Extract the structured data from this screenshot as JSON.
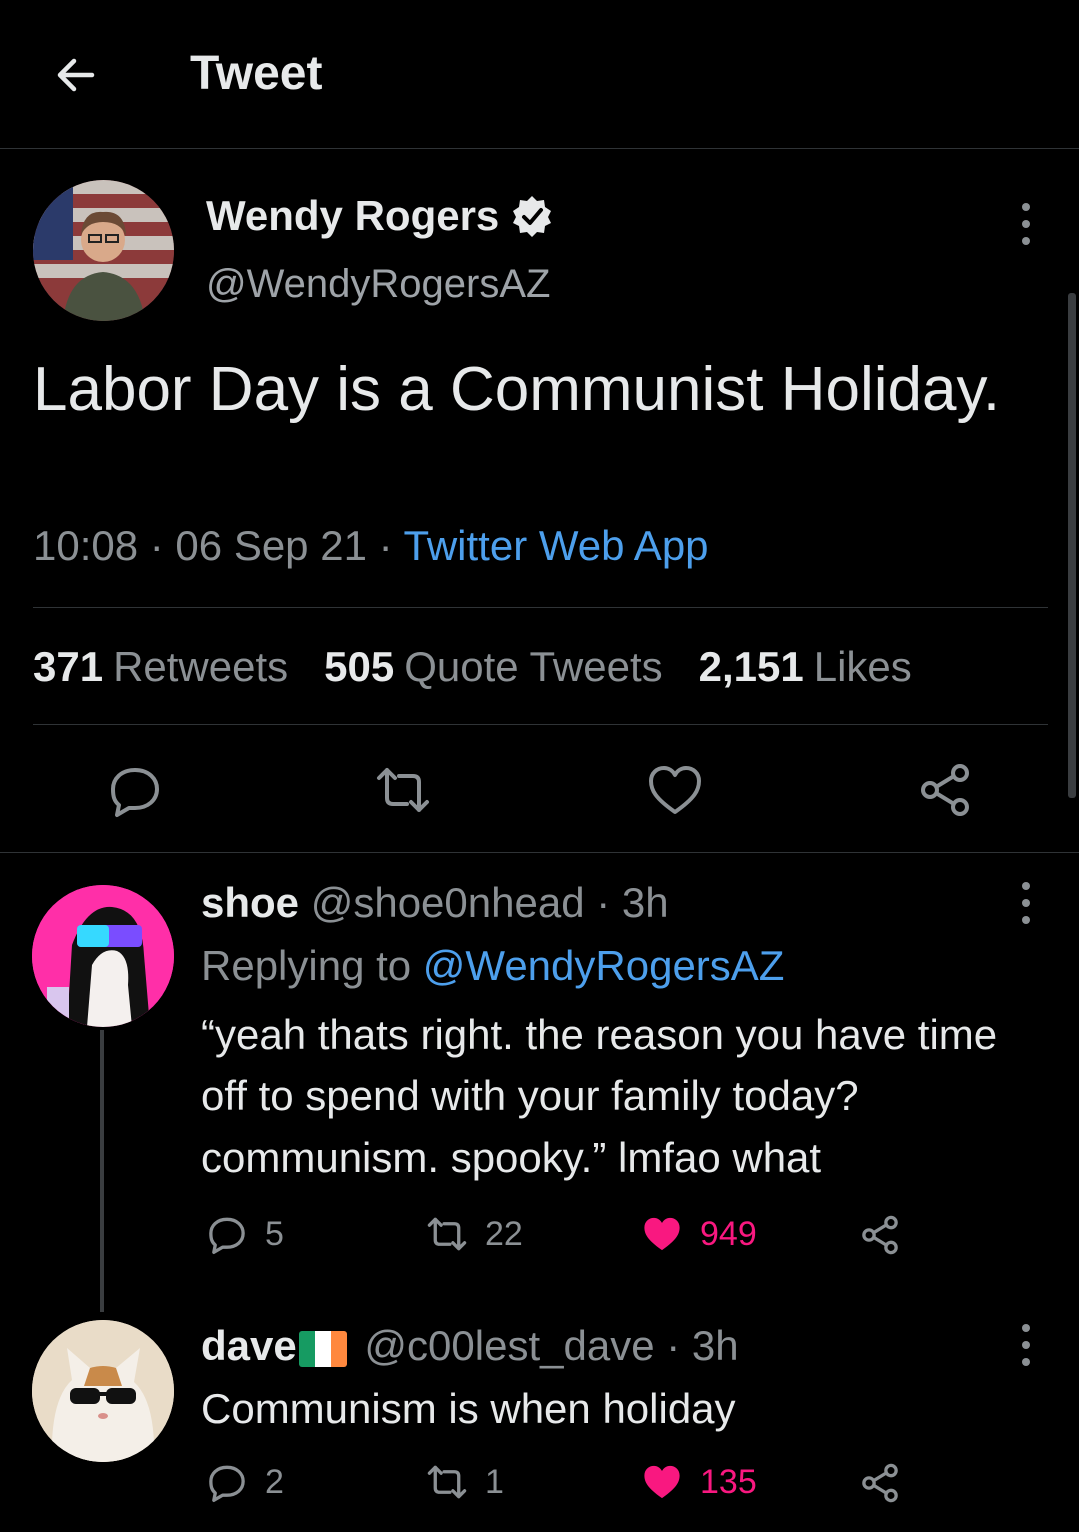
{
  "header": {
    "title": "Tweet"
  },
  "main_tweet": {
    "author_name": "Wendy Rogers",
    "handle": "@WendyRogersAZ",
    "text": "Labor Day is a Communist Holiday.",
    "time": "10:08 · 06 Sep 21 · ",
    "source": "Twitter Web App",
    "stats": {
      "retweets_count": "371",
      "retweets_label": "Retweets",
      "quotes_count": "505",
      "quotes_label": "Quote Tweets",
      "likes_count": "2,151",
      "likes_label": "Likes"
    }
  },
  "replies": [
    {
      "author_name": "shoe",
      "handle_time": "@shoe0nhead · 3h",
      "replying_prefix": "Replying to ",
      "replying_handle": "@WendyRogersAZ",
      "text": "“yeah thats right. the reason you have time off to spend with your family today? communism. spooky.” lmfao what",
      "reply_count": "5",
      "retweet_count": "22",
      "like_count": "949"
    },
    {
      "author_name": "dave",
      "handle_time": "@c00lest_dave · 3h",
      "text": "Communism is when holiday",
      "reply_count": "2",
      "retweet_count": "1",
      "like_count": "135"
    }
  ],
  "colors": {
    "background": "#000000",
    "link": "#4d9fec",
    "like": "#f91880",
    "muted": "#8b9094",
    "divider": "#2f3336"
  }
}
